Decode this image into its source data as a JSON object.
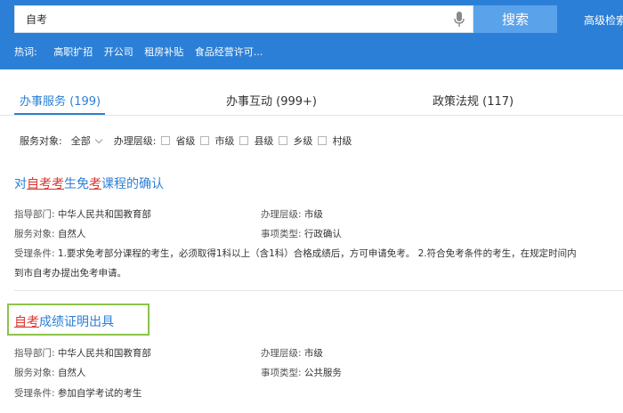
{
  "search": {
    "value": "自考",
    "button_label": "搜索",
    "advanced_label": "高级检索"
  },
  "hot": {
    "label": "热词:",
    "items": [
      "高职扩招",
      "开公司",
      "租房补贴",
      "食品经营许可..."
    ]
  },
  "tabs": [
    {
      "label": "办事服务 (199)",
      "active": true
    },
    {
      "label": "办事互动 (999+)",
      "active": false
    },
    {
      "label": "政策法规 (117)",
      "active": false
    }
  ],
  "filters": {
    "target_label": "服务对象:",
    "target_value": "全部",
    "level_label": "办理层级:",
    "levels": [
      "省级",
      "市级",
      "县级",
      "乡级",
      "村级"
    ]
  },
  "results": [
    {
      "title_parts": [
        "对",
        "自考",
        "考",
        "生免",
        "考",
        "课程的确认"
      ],
      "dept_label": "指导部门:",
      "dept": "中华人民共和国教育部",
      "level_label": "办理层级:",
      "level": "市级",
      "target_label": "服务对象:",
      "target": "自然人",
      "type_label": "事项类型:",
      "type": "行政确认",
      "cond_label": "受理条件:",
      "cond_line1": "1.要求免考部分课程的考生，必须取得1科以上（含1科）合格成绩后，方可申请免考。 2.符合免考条件的考生，在规定时间内",
      "cond_line2": "到市自考办提出免考申请。"
    },
    {
      "title_parts": [
        "自考",
        "成绩证明出具"
      ],
      "dept_label": "指导部门:",
      "dept": "中华人民共和国教育部",
      "level_label": "办理层级:",
      "level": "市级",
      "target_label": "服务对象:",
      "target": "自然人",
      "type_label": "事项类型:",
      "type": "公共服务",
      "cond_label": "受理条件:",
      "cond_line1": "参加自学考试的考生"
    }
  ],
  "colors": {
    "header_bg": "#2c7fd6",
    "search_btn": "#5aa2ea",
    "link": "#2c7fd6",
    "highlight": "#d9342b",
    "focus_box": "#8bc34a"
  },
  "icons": {
    "mic": "microphone-icon",
    "chevron": "chevron-down-icon"
  }
}
